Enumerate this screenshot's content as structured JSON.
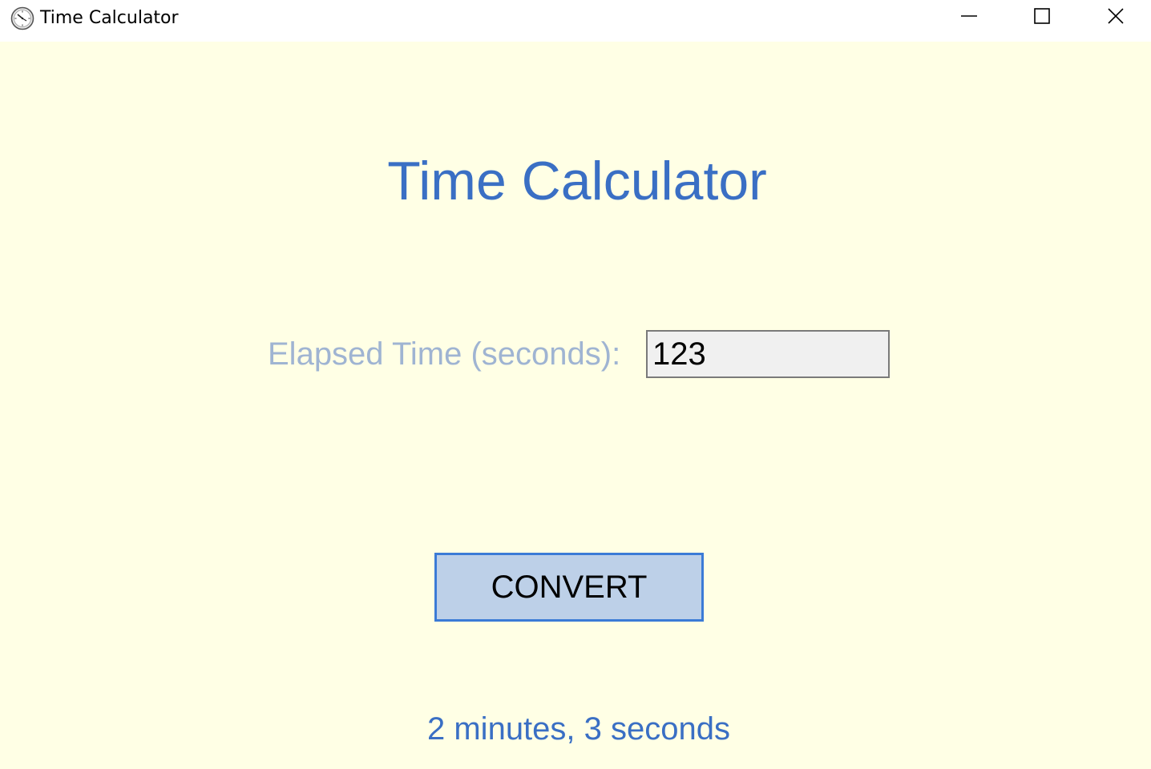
{
  "window": {
    "title": "Time Calculator",
    "icon": "clock-icon",
    "controls": [
      "minimize-icon",
      "maximize-icon",
      "close-icon"
    ]
  },
  "main": {
    "heading": "Time Calculator",
    "elapsed_label": "Elapsed Time (seconds):",
    "elapsed_value": "123",
    "convert_label": "CONVERT",
    "result": "2 minutes, 3 seconds"
  },
  "colors": {
    "background": "#ffffe5",
    "heading": "#3a6fc4",
    "label": "#9fb4d2",
    "button_fill": "#bdd0e8",
    "button_border": "#3b7bd6"
  }
}
